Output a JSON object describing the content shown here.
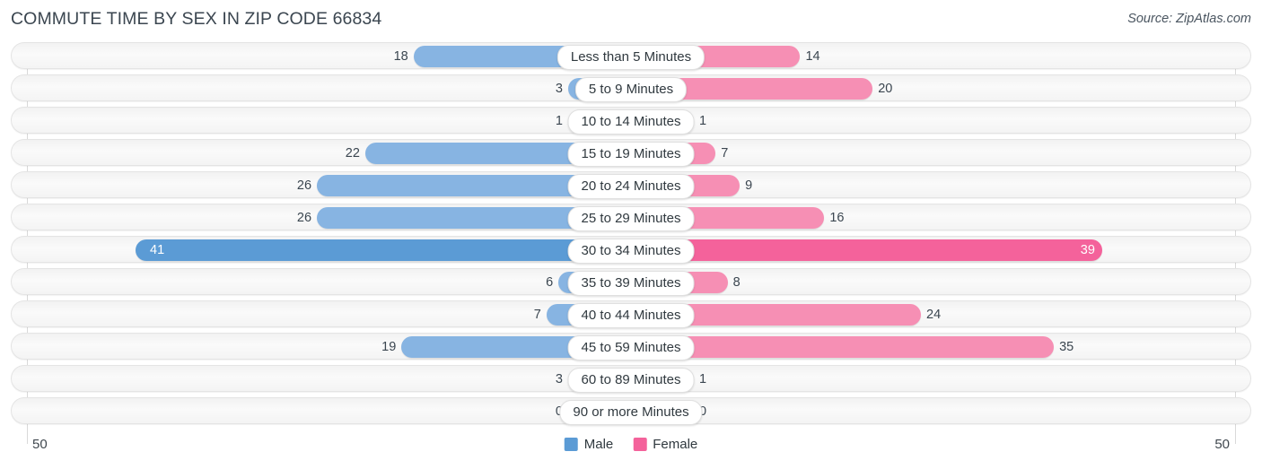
{
  "header": {
    "title": "COMMUTE TIME BY SEX IN ZIP CODE 66834",
    "source": "Source: ZipAtlas.com"
  },
  "footer": {
    "axis_left": "50",
    "axis_right": "50",
    "legend": [
      {
        "label": "Male",
        "color": "#5b9bd5"
      },
      {
        "label": "Female",
        "color": "#f4629b"
      }
    ]
  },
  "colors": {
    "male_light": "#87b4e2",
    "male_dark": "#5b9bd5",
    "female_light": "#f68fb4",
    "female_dark": "#f4629b",
    "track": "#f4f4f4",
    "gridline": "#d9d9d9",
    "text": "#3b4650"
  },
  "chart_data": {
    "type": "bar",
    "title": "COMMUTE TIME BY SEX IN ZIP CODE 66834",
    "subtitle": "Source: ZipAtlas.com",
    "orientation": "horizontal-diverging",
    "xlabel": "",
    "ylabel": "",
    "axis_max": 50,
    "axis_ticks": [
      "50",
      "50"
    ],
    "grid": true,
    "legend_position": "bottom-center",
    "categories": [
      "Less than 5 Minutes",
      "5 to 9 Minutes",
      "10 to 14 Minutes",
      "15 to 19 Minutes",
      "20 to 24 Minutes",
      "25 to 29 Minutes",
      "30 to 34 Minutes",
      "35 to 39 Minutes",
      "40 to 44 Minutes",
      "45 to 59 Minutes",
      "60 to 89 Minutes",
      "90 or more Minutes"
    ],
    "series": [
      {
        "name": "Male",
        "side": "left",
        "color": "#5b9bd5",
        "values": [
          18,
          3,
          1,
          22,
          26,
          26,
          41,
          6,
          7,
          19,
          3,
          0
        ]
      },
      {
        "name": "Female",
        "side": "right",
        "color": "#f4629b",
        "values": [
          14,
          20,
          1,
          7,
          9,
          16,
          39,
          8,
          24,
          35,
          1,
          0
        ]
      }
    ]
  }
}
